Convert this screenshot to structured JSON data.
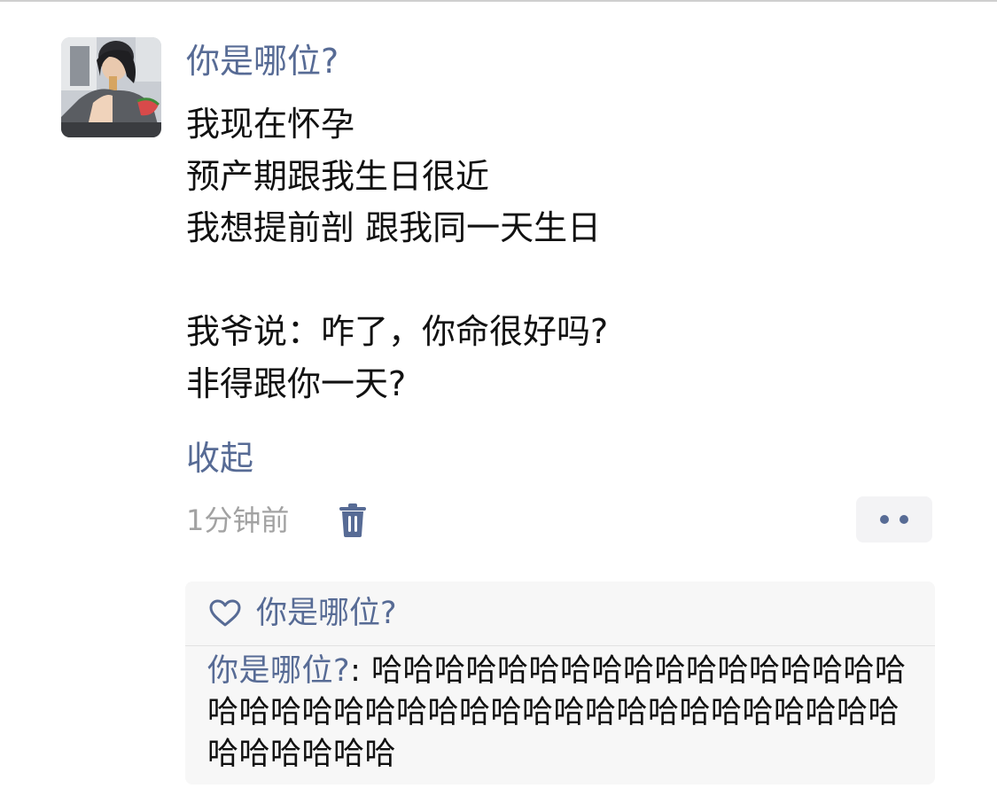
{
  "post": {
    "author": "你是哪位?",
    "lines": [
      "我现在怀孕",
      "预产期跟我生日很近",
      "我想提前剖 跟我同一天生日",
      "",
      "我爷说：咋了，你命很好吗?",
      "非得跟你一天?"
    ],
    "collapse_label": "收起",
    "time": "1分钟前"
  },
  "icons": {
    "delete": "trash-icon",
    "more": "more-dots-icon",
    "like": "heart-outline-icon"
  },
  "interactions": {
    "like_name": "你是哪位?",
    "comment": {
      "author": "你是哪位?",
      "separator": ": ",
      "text": "哈哈哈哈哈哈哈哈哈哈哈哈哈哈哈哈哈哈哈哈哈哈哈哈哈哈哈哈哈哈哈哈哈哈哈哈哈哈哈哈哈哈哈哈哈"
    }
  },
  "colors": {
    "link": "#576b95",
    "text": "#111111",
    "meta": "#a2a2a2",
    "panel": "#f7f7f7"
  }
}
